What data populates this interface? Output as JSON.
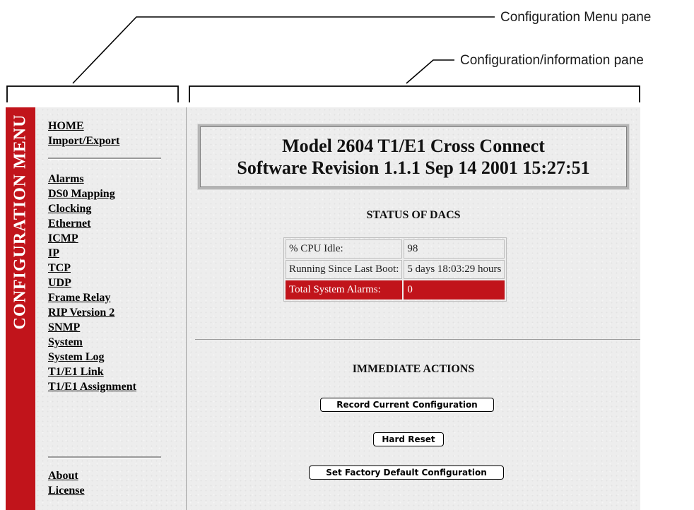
{
  "annotations": {
    "menu_pane_label": "Configuration Menu pane",
    "info_pane_label": "Configuration/information pane"
  },
  "menu": {
    "band_label": "CONFIGURATION MENU",
    "group1": [
      "HOME",
      "Import/Export"
    ],
    "group2": [
      "Alarms",
      "DS0 Mapping",
      "Clocking",
      "Ethernet",
      "ICMP",
      "IP",
      "TCP",
      "UDP",
      "Frame Relay",
      "RIP Version 2",
      "SNMP",
      "System",
      "System Log",
      "T1/E1 Link",
      "T1/E1 Assignment"
    ],
    "group3": [
      "About",
      "License"
    ]
  },
  "info": {
    "title_line1": "Model 2604 T1/E1 Cross Connect",
    "title_line2": "Software Revision 1.1.1 Sep 14 2001 15:27:51",
    "status_heading": "STATUS OF DACS",
    "status_rows": [
      {
        "label": "% CPU Idle:",
        "value": "98"
      },
      {
        "label": "Running Since Last Boot:",
        "value": "5 days 18:03:29 hours"
      },
      {
        "label": "Total System Alarms:",
        "value": "0"
      }
    ],
    "actions_heading": "IMMEDIATE ACTIONS",
    "btn_record": "Record Current Configuration",
    "btn_reset": "Hard Reset",
    "btn_factory": "Set Factory Default Configuration"
  },
  "colors": {
    "accent_red": "#c1141b",
    "background_gray": "#ededed"
  }
}
